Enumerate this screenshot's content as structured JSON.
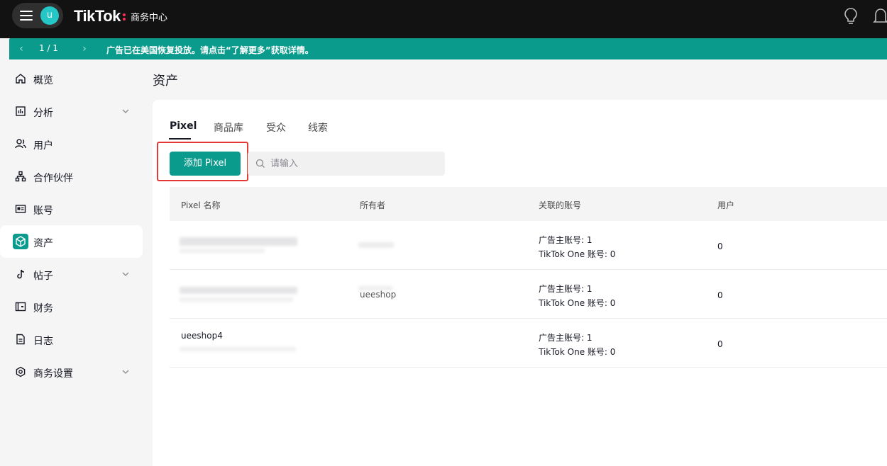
{
  "header": {
    "avatar_letter": "u",
    "brand": "TikTok",
    "brand_sub": "商务中心"
  },
  "notice": {
    "pager": "1 / 1",
    "message": "广告已在美国恢复投放。请点击“了解更多”获取详情。"
  },
  "sidebar": {
    "items": [
      {
        "label": "概览",
        "icon": "home-icon",
        "has_chevron": false
      },
      {
        "label": "分析",
        "icon": "chart-icon",
        "has_chevron": true
      },
      {
        "label": "用户",
        "icon": "users-icon",
        "has_chevron": false
      },
      {
        "label": "合作伙伴",
        "icon": "partners-icon",
        "has_chevron": false
      },
      {
        "label": "账号",
        "icon": "id-card-icon",
        "has_chevron": false
      },
      {
        "label": "资产",
        "icon": "cube-icon",
        "has_chevron": false,
        "active": true
      },
      {
        "label": "帖子",
        "icon": "tiktok-note-icon",
        "has_chevron": true
      },
      {
        "label": "财务",
        "icon": "wallet-icon",
        "has_chevron": false
      },
      {
        "label": "日志",
        "icon": "document-icon",
        "has_chevron": false
      },
      {
        "label": "商务设置",
        "icon": "settings-icon",
        "has_chevron": true
      }
    ]
  },
  "page": {
    "title": "资产"
  },
  "tabs": [
    {
      "label": "Pixel",
      "active": true
    },
    {
      "label": "商品库",
      "active": false
    },
    {
      "label": "受众",
      "active": false
    },
    {
      "label": "线索",
      "active": false
    }
  ],
  "toolbar": {
    "add_label": "添加 Pixel",
    "search_placeholder": "请输入"
  },
  "table": {
    "columns": [
      "Pixel 名称",
      "所有者",
      "关联的账号",
      "用户"
    ],
    "rows": [
      {
        "name": "",
        "owner": "",
        "advertiser": "广告主账号: 1",
        "tiktok_one": "TikTok One 账号: 0",
        "users": "0"
      },
      {
        "name": "",
        "owner": "ueeshop",
        "advertiser": "广告主账号: 1",
        "tiktok_one": "TikTok One 账号: 0",
        "users": "0"
      },
      {
        "name": "ueeshop4",
        "owner": "",
        "advertiser": "广告主账号: 1",
        "tiktok_one": "TikTok One 账号: 0",
        "users": "0"
      }
    ]
  },
  "colors": {
    "accent": "#0b9b8c",
    "header_bg": "#121212",
    "highlight": "#e53935"
  }
}
